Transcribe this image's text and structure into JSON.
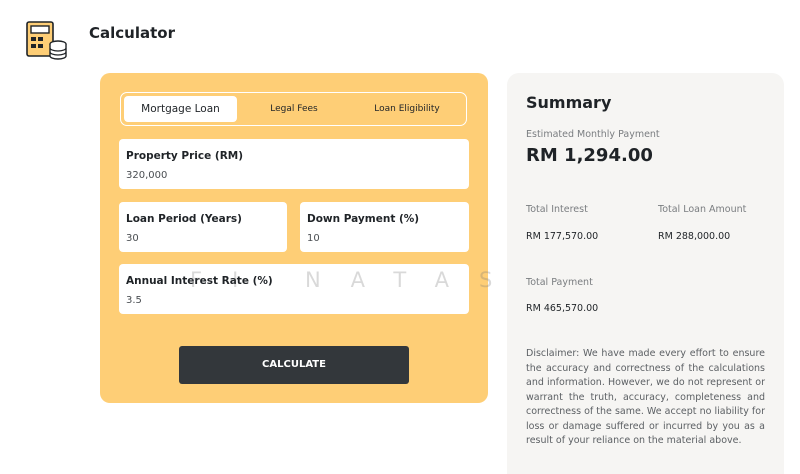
{
  "header": {
    "title": "Calculator",
    "logo_icon": "calculator-icon"
  },
  "tabs": [
    {
      "label": "Mortgage Loan",
      "active": true
    },
    {
      "label": "Legal Fees",
      "active": false
    },
    {
      "label": "Loan Eligibility",
      "active": false
    }
  ],
  "form": {
    "property_price": {
      "label": "Property Price (RM)",
      "value": "320,000"
    },
    "loan_period": {
      "label": "Loan Period (Years)",
      "value": "30"
    },
    "down_payment": {
      "label": "Down Payment (%)",
      "value": "10"
    },
    "interest_rate": {
      "label": "Annual Interest Rate (%)",
      "value": "3.5"
    },
    "calculate_label": "CALCULATE"
  },
  "watermark": "FI NATASYA",
  "summary": {
    "title": "Summary",
    "monthly_label": "Estimated Monthly Payment",
    "monthly_value": "RM 1,294.00",
    "total_interest_label": "Total Interest",
    "total_interest_value": "RM 177,570.00",
    "total_loan_label": "Total Loan Amount",
    "total_loan_value": "RM 288,000.00",
    "total_payment_label": "Total Payment",
    "total_payment_value": "RM 465,570.00",
    "disclaimer": "Disclaimer: We have made every effort to ensure the accuracy and correctness of the calculations and information. However, we do not represent or warrant the truth, accuracy, completeness and correctness of the same. We accept no liability for loss or damage suffered or incurred by you as a result of your reliance on the material above."
  },
  "colors": {
    "panel": "#fece76",
    "button": "#33373b",
    "summary_bg": "#f6f5f3"
  }
}
